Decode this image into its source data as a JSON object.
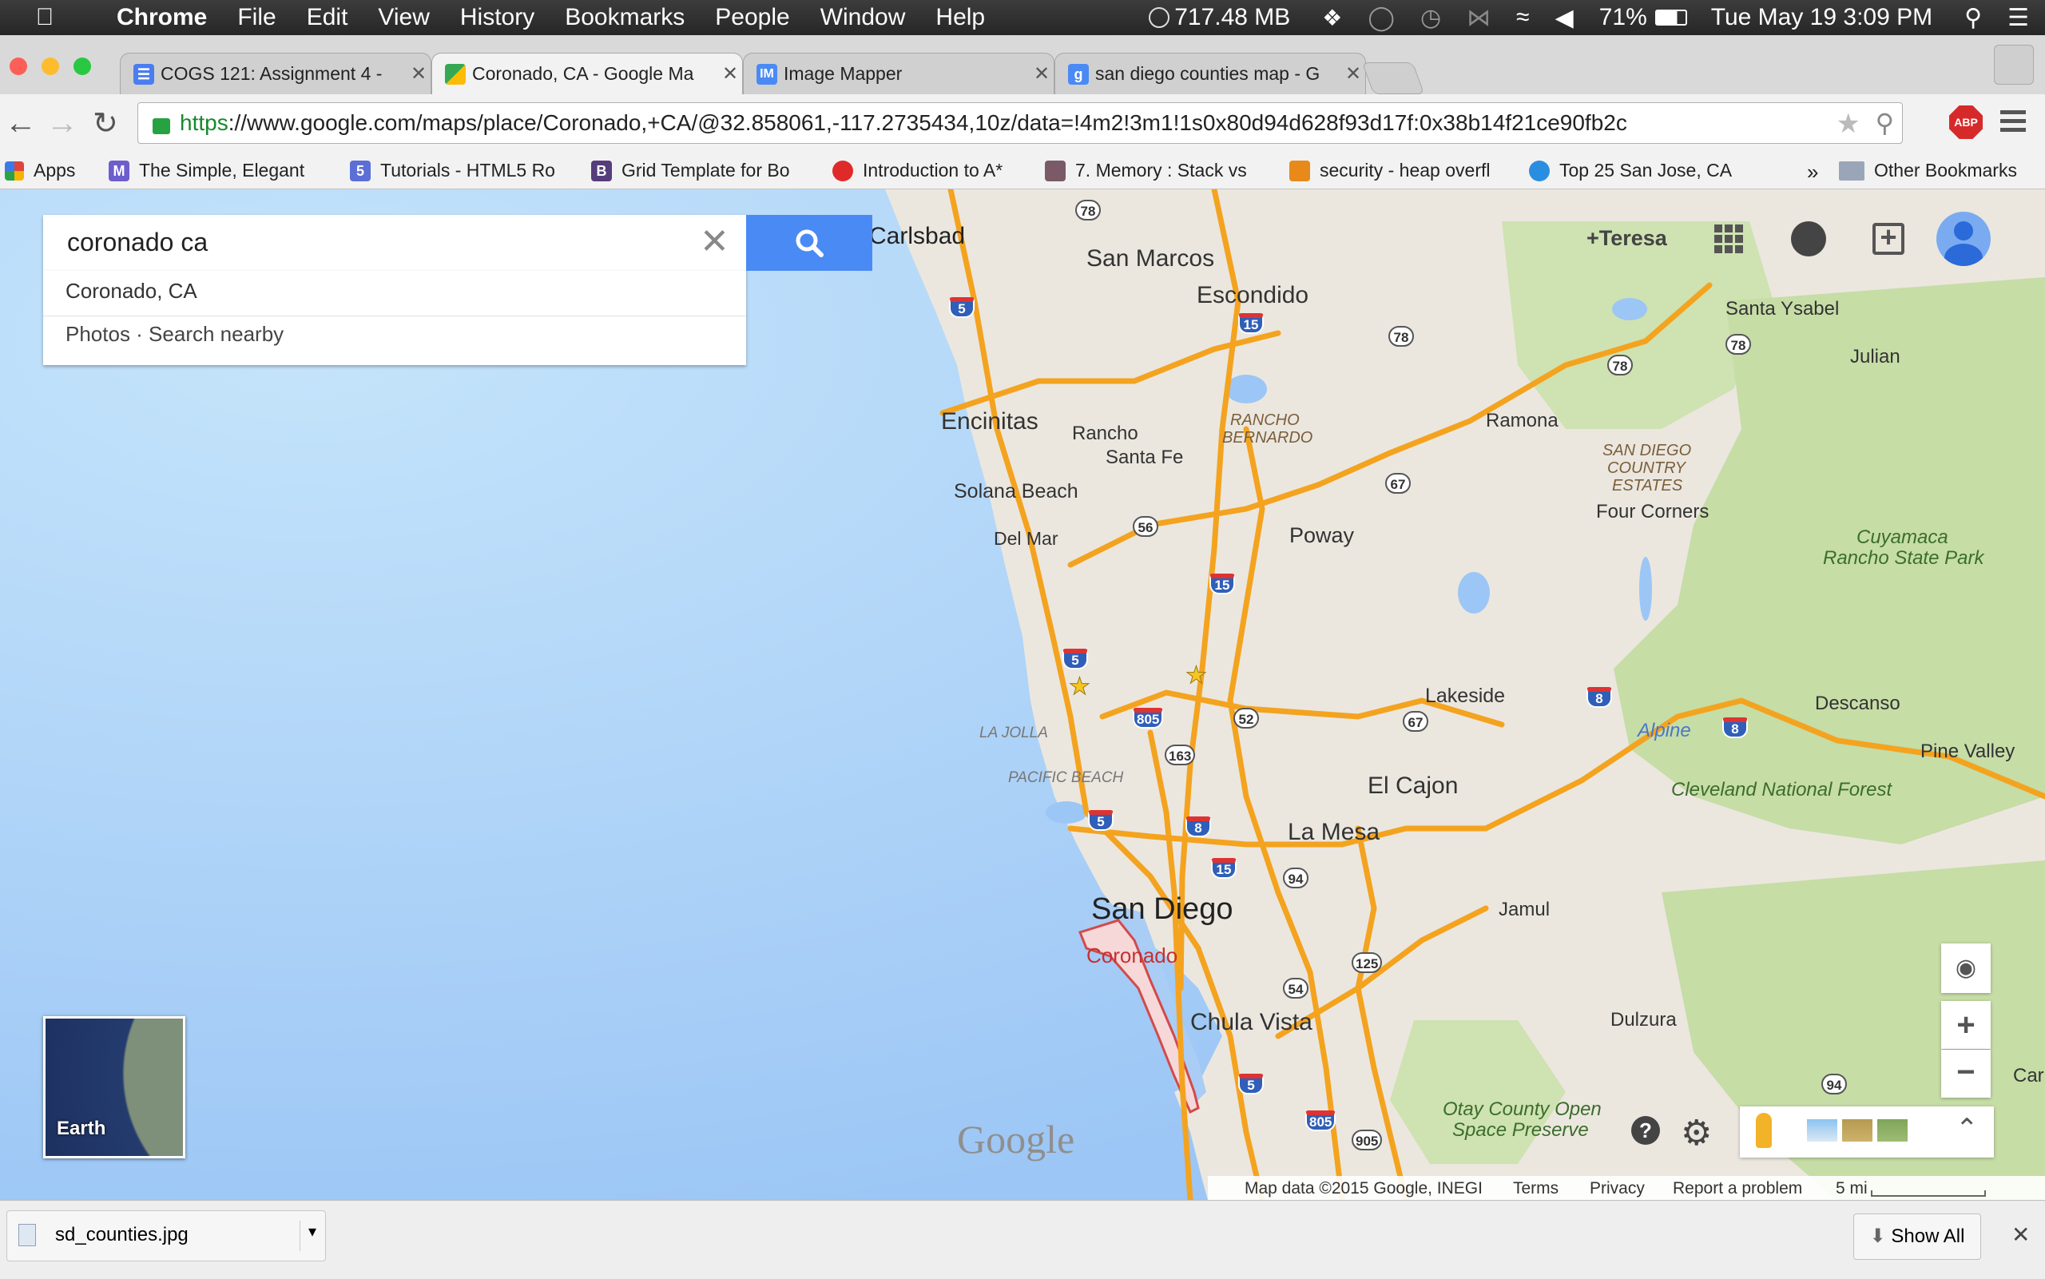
{
  "menubar": {
    "app": "Chrome",
    "items": [
      "File",
      "Edit",
      "View",
      "History",
      "Bookmarks",
      "People",
      "Window",
      "Help"
    ],
    "memory": "717.48 MB",
    "battery": "71%",
    "datetime": "Tue May 19  3:09 PM"
  },
  "tabs": [
    {
      "title": "COGS 121: Assignment 4 -",
      "icon": "google-docs-icon",
      "color": "#4a7df0"
    },
    {
      "title": "Coronado, CA - Google Ma",
      "icon": "google-maps-icon",
      "color": "#34a853"
    },
    {
      "title": "Image Mapper",
      "icon": "image-mapper-icon",
      "color": "#4a8af4",
      "badge": "IM"
    },
    {
      "title": "san diego counties map - G",
      "icon": "google-search-icon",
      "color": "#4a8af4",
      "badge": "g"
    }
  ],
  "toolbar": {
    "url_scheme": "https",
    "url_rest": "://www.google.com/maps/place/Coronado,+CA/@32.858061,-117.2735434,10z/data=!4m2!3m1!1s0x80d94d628f93d17f:0x38b14f21ce90fb2c",
    "abp_label": "ABP"
  },
  "bookmarks": {
    "items": [
      {
        "label": "Apps",
        "badge": "",
        "color": "#e0443a"
      },
      {
        "label": "The Simple, Elegant",
        "badge": "M",
        "color": "#6c5ecf"
      },
      {
        "label": "Tutorials - HTML5 Ro",
        "badge": "5",
        "color": "#5b6fd6"
      },
      {
        "label": "Grid Template for Bo",
        "badge": "B",
        "color": "#563d7c"
      },
      {
        "label": "Introduction to A*",
        "badge": "",
        "color": "#e02a2a"
      },
      {
        "label": "7. Memory : Stack vs",
        "badge": "",
        "color": "#7a5a66"
      },
      {
        "label": "security - heap overfl",
        "badge": "",
        "color": "#e88a1a"
      },
      {
        "label": "Top 25 San Jose, CA",
        "badge": "",
        "color": "#2a8ee0"
      }
    ],
    "overflow": "»",
    "other": "Other Bookmarks"
  },
  "search": {
    "value": "coronado ca",
    "suggestion_title": "Coronado, CA",
    "suggestion_actions": "Photos · Search nearby"
  },
  "account": {
    "name": "+Teresa"
  },
  "earth": {
    "label": "Earth"
  },
  "logo": "Google",
  "places": {
    "carlsbad": "Carlsbad",
    "san_marcos": "San Marcos",
    "escondido": "Escondido",
    "santa_ysabel": "Santa Ysabel",
    "julian": "Julian",
    "encinitas": "Encinitas",
    "rancho_santa_fe_1": "Rancho",
    "rancho_santa_fe_2": "Santa Fe",
    "rancho_bernardo_1": "RANCHO",
    "rancho_bernardo_2": "BERNARDO",
    "ramona": "Ramona",
    "sd_country_estates_1": "SAN DIEGO",
    "sd_country_estates_2": "COUNTRY",
    "sd_country_estates_3": "ESTATES",
    "solana_beach": "Solana Beach",
    "four_corners": "Four Corners",
    "del_mar": "Del Mar",
    "poway": "Poway",
    "cuyamaca_1": "Cuyamaca",
    "cuyamaca_2": "Rancho State Park",
    "lakeside": "Lakeside",
    "descanso": "Descanso",
    "la_jolla": "LA JOLLA",
    "alpine": "Alpine",
    "pine_valley": "Pine Valley",
    "pacific_beach": "PACIFIC BEACH",
    "el_cajon": "El Cajon",
    "cleveland": "Cleveland National Forest",
    "la_mesa": "La Mesa",
    "san_diego": "San Diego",
    "jamul": "Jamul",
    "coronado": "Coronado",
    "chula_vista": "Chula Vista",
    "dulzura": "Dulzura",
    "otay_1": "Otay County Open",
    "otay_2": "Space Preserve",
    "car": "Car"
  },
  "shields": [
    "78",
    "5",
    "15",
    "78",
    "78",
    "78",
    "67",
    "56",
    "15",
    "5",
    "805",
    "52",
    "67",
    "8",
    "8",
    "163",
    "5",
    "8",
    "15",
    "94",
    "125",
    "54",
    "5",
    "805",
    "905",
    "94"
  ],
  "footer": {
    "mapdata": "Map data ©2015 Google, INEGI",
    "terms": "Terms",
    "privacy": "Privacy",
    "report": "Report a problem",
    "scale": "5 mi"
  },
  "downloads": {
    "file": "sd_counties.jpg",
    "show_all": "Show All"
  }
}
